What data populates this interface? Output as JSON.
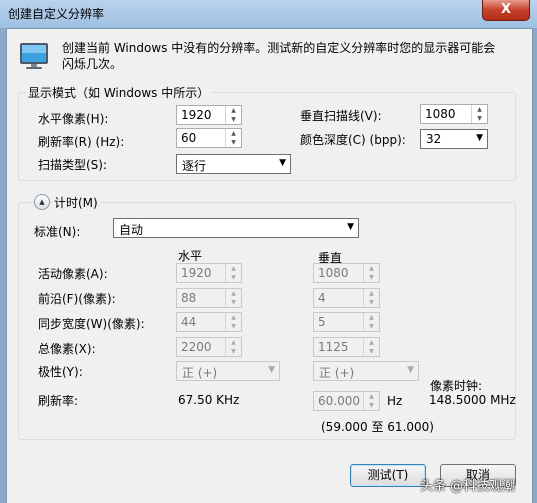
{
  "window": {
    "title": "创建自定义分辨率",
    "close_label": "X"
  },
  "intro_text": "创建当前 Windows 中没有的分辨率。测试新的自定义分辨率时您的显示器可能会闪烁几次。",
  "display_mode": {
    "group_label": "显示模式（如 Windows 中所示）",
    "horizontal_pixels": {
      "label": "水平像素(H):",
      "value": "1920"
    },
    "refresh_rate": {
      "label": "刷新率(R) (Hz):",
      "value": "60"
    },
    "scan_type": {
      "label": "扫描类型(S):",
      "value": "逐行"
    },
    "vertical_lines": {
      "label": "垂直扫描线(V):",
      "value": "1080"
    },
    "color_depth": {
      "label": "颜色深度(C) (bpp):",
      "value": "32"
    }
  },
  "timing": {
    "toggle_label": "计时(M)",
    "standard": {
      "label": "标准(N):",
      "value": "自动"
    },
    "col_horizontal": "水平",
    "col_vertical": "垂直",
    "active_pixels": {
      "label": "活动像素(A):",
      "h": "1920",
      "v": "1080"
    },
    "front_porch": {
      "label": "前沿(F)(像素):",
      "h": "88",
      "v": "4"
    },
    "sync_width": {
      "label": "同步宽度(W)(像素):",
      "h": "44",
      "v": "5"
    },
    "total_pixels": {
      "label": "总像素(X):",
      "h": "2200",
      "v": "1125"
    },
    "polarity": {
      "label": "极性(Y):",
      "h": "正 (+)",
      "v": "正 (+)"
    },
    "refresh": {
      "label": "刷新率:",
      "h_value": "67.50 KHz",
      "v_value": "60.000",
      "v_unit": "Hz",
      "range": "(59.000 至 61.000)"
    },
    "pixel_clock": {
      "label": "像素时钟:",
      "value": "148.5000 MHz"
    }
  },
  "buttons": {
    "test": "测试(T)",
    "cancel": "取消"
  },
  "watermark": "头条 @科技观潮"
}
